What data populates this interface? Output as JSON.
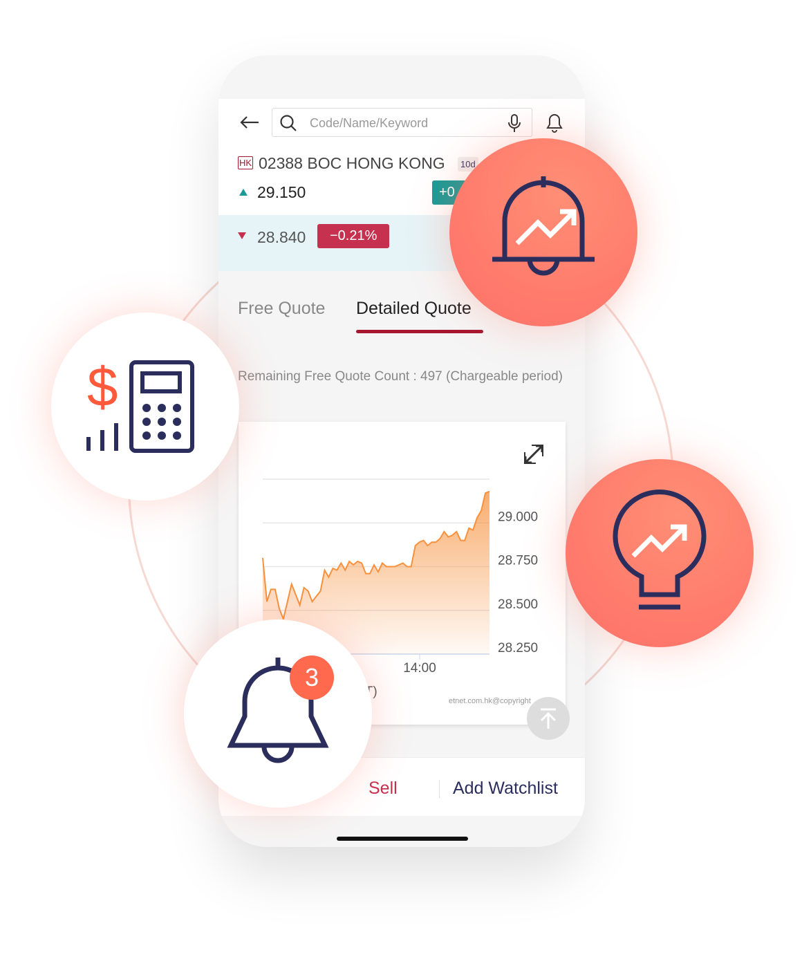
{
  "header": {
    "search_placeholder": "Code/Name/Keyword"
  },
  "stock": {
    "market": "HK",
    "code_name": "02388 BOC HONG KONG",
    "tag": "10d",
    "price": "29.150",
    "change_badge": "+0",
    "prev_price": "28.840",
    "prev_change": "−0.21%"
  },
  "tabs": [
    {
      "label": "Free Quote"
    },
    {
      "label": "Detailed Quote",
      "active": true
    }
  ],
  "remaining_text": "Remaining Free Quote Count : 497  (Chargeable period)",
  "chart_footer": {
    "timezone": "(HKT)",
    "copyright": "etnet.com.hk@copyright"
  },
  "actions": {
    "sell": "Sell",
    "watchlist": "Add Watchlist"
  },
  "badge_count": "3",
  "colors": {
    "accent": "#a6162f",
    "up": "#1a9a96",
    "down": "#c5314f",
    "line": "#f7913d",
    "coral": "#ff7b6b",
    "navy": "#2b2d5c"
  },
  "chart_data": {
    "type": "area",
    "ylim": [
      28.25,
      29.25
    ],
    "yticks": [
      "29.000",
      "28.750",
      "28.500",
      "28.250"
    ],
    "ytick_values": [
      29.0,
      28.75,
      28.5,
      28.25
    ],
    "xticks": [
      "14:00"
    ],
    "grid": true,
    "values": [
      28.8,
      28.55,
      28.62,
      28.62,
      28.51,
      28.45,
      28.55,
      28.65,
      28.59,
      28.53,
      28.63,
      28.61,
      28.55,
      28.58,
      28.61,
      28.73,
      28.69,
      28.74,
      28.73,
      28.77,
      28.73,
      28.78,
      28.76,
      28.78,
      28.77,
      28.71,
      28.71,
      28.76,
      28.72,
      28.77,
      28.75,
      28.75,
      28.75,
      28.76,
      28.77,
      28.75,
      28.75,
      28.87,
      28.89,
      28.9,
      28.87,
      28.89,
      28.89,
      28.91,
      28.95,
      28.92,
      28.93,
      28.95,
      28.9,
      28.9,
      28.97,
      28.96,
      29.03,
      29.07,
      29.17,
      29.18
    ]
  }
}
